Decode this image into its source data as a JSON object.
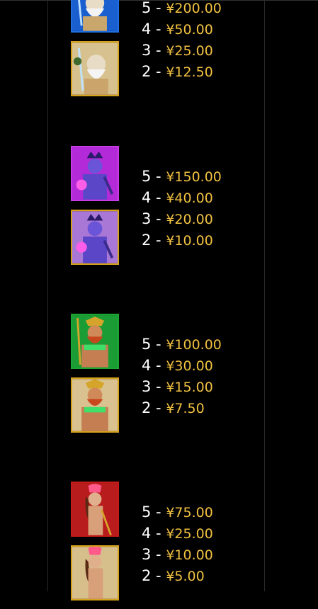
{
  "currency_symbol": "¥",
  "colors": {
    "background": "#000000",
    "amount": "#f1c141",
    "count": "#ffffff"
  },
  "symbols": [
    {
      "name": "zeus",
      "tile_colors": [
        "#1f6fe0",
        "#d6a21c"
      ],
      "pays": [
        {
          "count": "5",
          "amount": "¥200.00"
        },
        {
          "count": "4",
          "amount": "¥50.00"
        },
        {
          "count": "3",
          "amount": "¥25.00"
        },
        {
          "count": "2",
          "amount": "¥12.50"
        }
      ]
    },
    {
      "name": "hades",
      "tile_colors": [
        "#b320d6",
        "#d6a21c"
      ],
      "pays": [
        {
          "count": "5",
          "amount": "¥150.00"
        },
        {
          "count": "4",
          "amount": "¥40.00"
        },
        {
          "count": "3",
          "amount": "¥20.00"
        },
        {
          "count": "2",
          "amount": "¥10.00"
        }
      ]
    },
    {
      "name": "poseidon",
      "tile_colors": [
        "#1ba832",
        "#d6a21c"
      ],
      "pays": [
        {
          "count": "5",
          "amount": "¥100.00"
        },
        {
          "count": "4",
          "amount": "¥30.00"
        },
        {
          "count": "3",
          "amount": "¥15.00"
        },
        {
          "count": "2",
          "amount": "¥7.50"
        }
      ]
    },
    {
      "name": "athena",
      "tile_colors": [
        "#c51a1a",
        "#d6a21c"
      ],
      "pays": [
        {
          "count": "5",
          "amount": "¥75.00"
        },
        {
          "count": "4",
          "amount": "¥25.00"
        },
        {
          "count": "3",
          "amount": "¥10.00"
        },
        {
          "count": "2",
          "amount": "¥5.00"
        }
      ]
    }
  ]
}
